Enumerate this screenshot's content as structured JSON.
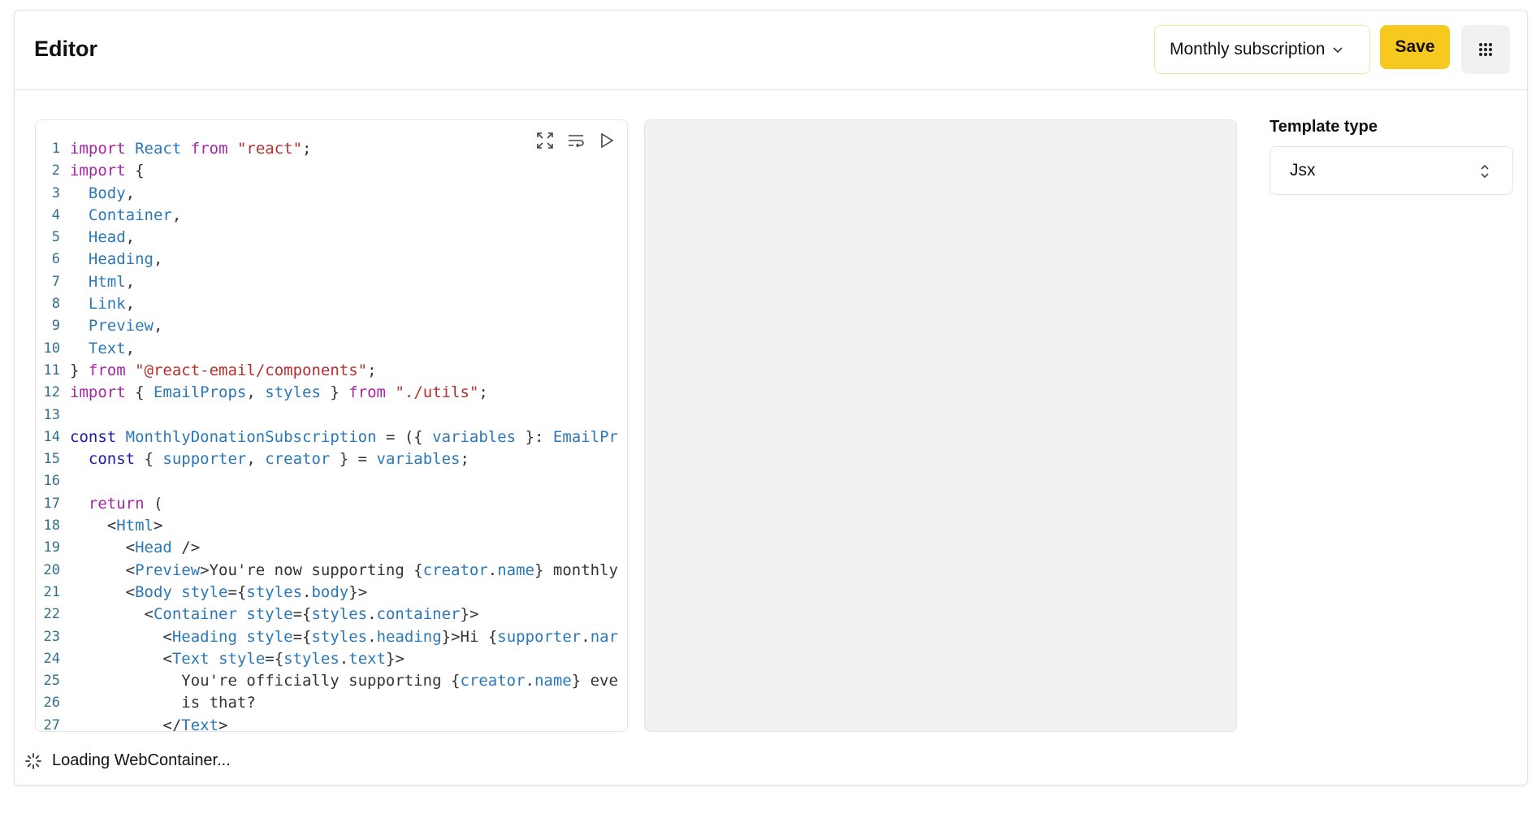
{
  "header": {
    "title": "Editor",
    "template_dropdown": "Monthly subscription",
    "save_label": "Save",
    "menu_icon": "grid-dots-icon"
  },
  "editor": {
    "toolbar_icons": [
      "expand-icon",
      "wrap-text-icon",
      "run-icon"
    ],
    "lines": [
      {
        "n": "1",
        "tokens": [
          [
            "kw",
            "import"
          ],
          [
            "p",
            " "
          ],
          [
            "id",
            "React"
          ],
          [
            "p",
            " "
          ],
          [
            "kw",
            "from"
          ],
          [
            "p",
            " "
          ],
          [
            "str",
            "\"react\""
          ],
          [
            "p",
            ";"
          ]
        ]
      },
      {
        "n": "2",
        "tokens": [
          [
            "kw",
            "import"
          ],
          [
            "p",
            " {"
          ]
        ]
      },
      {
        "n": "3",
        "tokens": [
          [
            "p",
            "  "
          ],
          [
            "id",
            "Body"
          ],
          [
            "p",
            ","
          ]
        ]
      },
      {
        "n": "4",
        "tokens": [
          [
            "p",
            "  "
          ],
          [
            "id",
            "Container"
          ],
          [
            "p",
            ","
          ]
        ]
      },
      {
        "n": "5",
        "tokens": [
          [
            "p",
            "  "
          ],
          [
            "id",
            "Head"
          ],
          [
            "p",
            ","
          ]
        ]
      },
      {
        "n": "6",
        "tokens": [
          [
            "p",
            "  "
          ],
          [
            "id",
            "Heading"
          ],
          [
            "p",
            ","
          ]
        ]
      },
      {
        "n": "7",
        "tokens": [
          [
            "p",
            "  "
          ],
          [
            "id",
            "Html"
          ],
          [
            "p",
            ","
          ]
        ]
      },
      {
        "n": "8",
        "tokens": [
          [
            "p",
            "  "
          ],
          [
            "id",
            "Link"
          ],
          [
            "p",
            ","
          ]
        ]
      },
      {
        "n": "9",
        "tokens": [
          [
            "p",
            "  "
          ],
          [
            "id",
            "Preview"
          ],
          [
            "p",
            ","
          ]
        ]
      },
      {
        "n": "10",
        "tokens": [
          [
            "p",
            "  "
          ],
          [
            "id",
            "Text"
          ],
          [
            "p",
            ","
          ]
        ]
      },
      {
        "n": "11",
        "tokens": [
          [
            "p",
            "} "
          ],
          [
            "kw",
            "from"
          ],
          [
            "p",
            " "
          ],
          [
            "str",
            "\"@react-email/components\""
          ],
          [
            "p",
            ";"
          ]
        ]
      },
      {
        "n": "12",
        "tokens": [
          [
            "kw",
            "import"
          ],
          [
            "p",
            " { "
          ],
          [
            "id",
            "EmailProps"
          ],
          [
            "p",
            ", "
          ],
          [
            "id",
            "styles"
          ],
          [
            "p",
            " } "
          ],
          [
            "kw",
            "from"
          ],
          [
            "p",
            " "
          ],
          [
            "str",
            "\"./utils\""
          ],
          [
            "p",
            ";"
          ]
        ]
      },
      {
        "n": "13",
        "tokens": []
      },
      {
        "n": "14",
        "tokens": [
          [
            "kw2",
            "const"
          ],
          [
            "p",
            " "
          ],
          [
            "id",
            "MonthlyDonationSubscription"
          ],
          [
            "p",
            " = ({ "
          ],
          [
            "id",
            "variables"
          ],
          [
            "p",
            " }: "
          ],
          [
            "id",
            "EmailPr"
          ]
        ]
      },
      {
        "n": "15",
        "tokens": [
          [
            "p",
            "  "
          ],
          [
            "kw2",
            "const"
          ],
          [
            "p",
            " { "
          ],
          [
            "id",
            "supporter"
          ],
          [
            "p",
            ", "
          ],
          [
            "id",
            "creator"
          ],
          [
            "p",
            " } = "
          ],
          [
            "id",
            "variables"
          ],
          [
            "p",
            ";"
          ]
        ]
      },
      {
        "n": "16",
        "tokens": []
      },
      {
        "n": "17",
        "tokens": [
          [
            "p",
            "  "
          ],
          [
            "kw",
            "return"
          ],
          [
            "p",
            " ("
          ]
        ]
      },
      {
        "n": "18",
        "tokens": [
          [
            "p",
            "    <"
          ],
          [
            "tag",
            "Html"
          ],
          [
            "p",
            ">"
          ]
        ]
      },
      {
        "n": "19",
        "tokens": [
          [
            "p",
            "      <"
          ],
          [
            "tag",
            "Head"
          ],
          [
            "p",
            " />"
          ]
        ]
      },
      {
        "n": "20",
        "tokens": [
          [
            "p",
            "      <"
          ],
          [
            "tag",
            "Preview"
          ],
          [
            "p",
            ">You're now supporting {"
          ],
          [
            "id",
            "creator"
          ],
          [
            "p",
            "."
          ],
          [
            "id",
            "name"
          ],
          [
            "p",
            "} monthly"
          ]
        ]
      },
      {
        "n": "21",
        "tokens": [
          [
            "p",
            "      <"
          ],
          [
            "tag",
            "Body"
          ],
          [
            "p",
            " "
          ],
          [
            "id",
            "style"
          ],
          [
            "p",
            "={"
          ],
          [
            "id",
            "styles"
          ],
          [
            "p",
            "."
          ],
          [
            "id",
            "body"
          ],
          [
            "p",
            "}>"
          ]
        ]
      },
      {
        "n": "22",
        "tokens": [
          [
            "p",
            "        <"
          ],
          [
            "tag",
            "Container"
          ],
          [
            "p",
            " "
          ],
          [
            "id",
            "style"
          ],
          [
            "p",
            "={"
          ],
          [
            "id",
            "styles"
          ],
          [
            "p",
            "."
          ],
          [
            "id",
            "container"
          ],
          [
            "p",
            "}>"
          ]
        ]
      },
      {
        "n": "23",
        "tokens": [
          [
            "p",
            "          <"
          ],
          [
            "tag",
            "Heading"
          ],
          [
            "p",
            " "
          ],
          [
            "id",
            "style"
          ],
          [
            "p",
            "={"
          ],
          [
            "id",
            "styles"
          ],
          [
            "p",
            "."
          ],
          [
            "id",
            "heading"
          ],
          [
            "p",
            "}>Hi {"
          ],
          [
            "id",
            "supporter"
          ],
          [
            "p",
            "."
          ],
          [
            "id",
            "nar"
          ]
        ]
      },
      {
        "n": "24",
        "tokens": [
          [
            "p",
            "          <"
          ],
          [
            "tag",
            "Text"
          ],
          [
            "p",
            " "
          ],
          [
            "id",
            "style"
          ],
          [
            "p",
            "={"
          ],
          [
            "id",
            "styles"
          ],
          [
            "p",
            "."
          ],
          [
            "id",
            "text"
          ],
          [
            "p",
            "}>"
          ]
        ]
      },
      {
        "n": "25",
        "tokens": [
          [
            "p",
            "            You're officially supporting {"
          ],
          [
            "id",
            "creator"
          ],
          [
            "p",
            "."
          ],
          [
            "id",
            "name"
          ],
          [
            "p",
            "} eve"
          ]
        ]
      },
      {
        "n": "26",
        "tokens": [
          [
            "p",
            "            is that?"
          ]
        ]
      },
      {
        "n": "27",
        "tokens": [
          [
            "p",
            "          </"
          ],
          [
            "tag",
            "Text"
          ],
          [
            "p",
            ">"
          ]
        ]
      }
    ]
  },
  "sidebar": {
    "template_type_label": "Template type",
    "template_type_value": "Jsx"
  },
  "status": {
    "text": "Loading WebContainer..."
  }
}
